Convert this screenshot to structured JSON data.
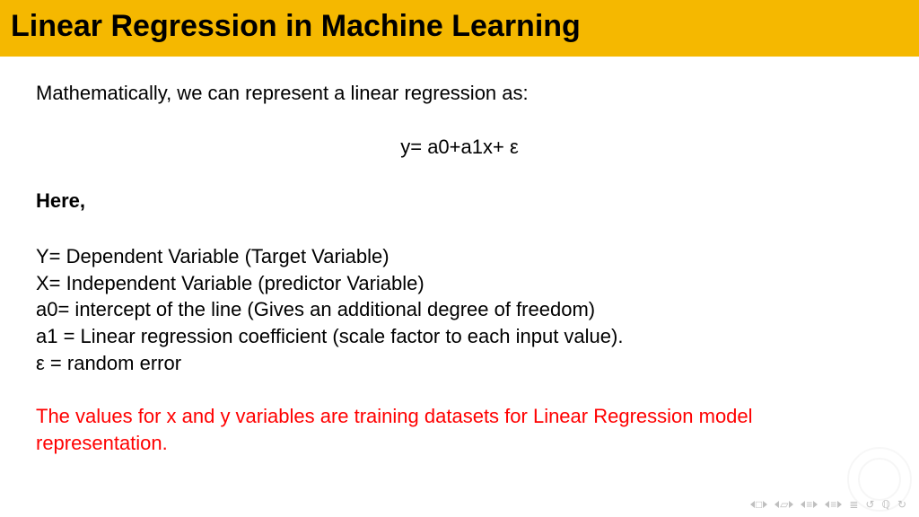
{
  "header": {
    "title": "Linear Regression in Machine Learning"
  },
  "body": {
    "intro": "Mathematically, we can represent a linear regression as:",
    "equation": "y= a0+a1x+ ε",
    "here_label": "Here,",
    "definitions": [
      "Y= Dependent Variable (Target Variable)",
      "X= Independent Variable (predictor Variable)",
      "a0= intercept of the line (Gives an additional degree of freedom)",
      "a1 = Linear regression coefficient (scale factor to each input value).",
      "ε = random error"
    ],
    "footnote": "The values for x and y variables are training datasets for Linear Regression model representation."
  }
}
